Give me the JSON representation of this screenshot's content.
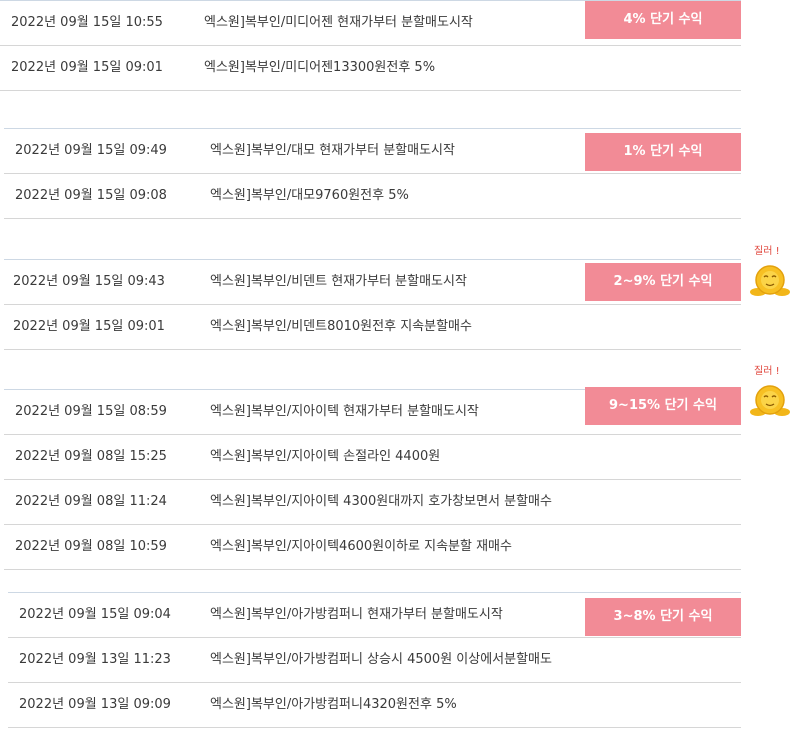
{
  "theme": {
    "badge_color": "#f28b96",
    "divider_color": "#d6d6d6",
    "group_border_color": "#cdd8e4"
  },
  "groups": [
    {
      "badge": "4% 단기 수익",
      "emoji": null,
      "rows": [
        {
          "date": "2022년 09월 15일 10:55",
          "text": "엑스원]복부인/미디어젠 현재가부터 분할매도시작"
        },
        {
          "date": "2022년 09월 15일 09:01",
          "text": "엑스원]복부인/미디어젠13300원전후 5%"
        }
      ]
    },
    {
      "badge": "1% 단기 수익",
      "emoji": null,
      "rows": [
        {
          "date": "2022년 09월 15일 09:49",
          "text": "엑스원]복부인/대모 현재가부터 분할매도시작"
        },
        {
          "date": "2022년 09월 15일 09:08",
          "text": "엑스원]복부인/대모9760원전후 5%"
        }
      ]
    },
    {
      "badge": "2~9% 단기 수익",
      "emoji": "질러 !",
      "rows": [
        {
          "date": "2022년 09월 15일 09:43",
          "text": "엑스원]복부인/비덴트 현재가부터 분할매도시작"
        },
        {
          "date": "2022년 09월 15일 09:01",
          "text": "엑스원]복부인/비덴트8010원전후 지속분할매수"
        }
      ]
    },
    {
      "badge": "9~15% 단기 수익",
      "emoji": "질러 !",
      "rows": [
        {
          "date": "2022년 09월 15일 08:59",
          "text": "엑스원]복부인/지아이텍 현재가부터 분할매도시작"
        },
        {
          "date": "2022년 09월 08일 15:25",
          "text": "엑스원]복부인/지아이텍 손절라인 4400원"
        },
        {
          "date": "2022년 09월 08일 11:24",
          "text": "엑스원]복부인/지아이텍 4300원대까지 호가창보면서 분할매수"
        },
        {
          "date": "2022년 09월 08일 10:59",
          "text": "엑스원]복부인/지아이텍4600원이하로 지속분할 재매수"
        }
      ]
    },
    {
      "badge": "3~8% 단기 수익",
      "emoji": null,
      "rows": [
        {
          "date": "2022년 09월 15일 09:04",
          "text": "엑스원]복부인/아가방컴퍼니 현재가부터 분할매도시작"
        },
        {
          "date": "2022년 09월 13일 11:23",
          "text": "엑스원]복부인/아가방컴퍼니 상승시 4500원 이상에서분할매도"
        },
        {
          "date": "2022년 09월 13일 09:09",
          "text": "엑스원]복부인/아가방컴퍼니4320원전후 5%"
        }
      ]
    }
  ]
}
